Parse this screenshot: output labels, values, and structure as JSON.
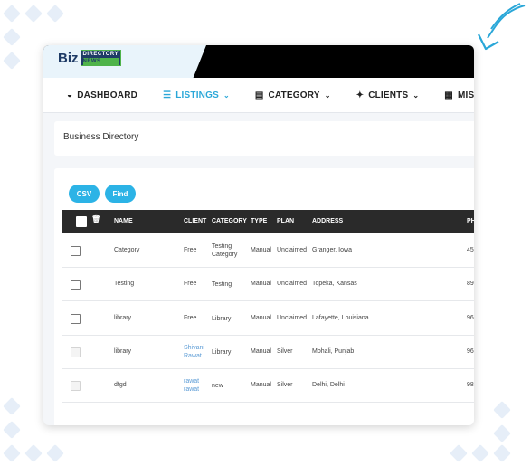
{
  "logo": {
    "biz": "Biz",
    "line1": "DIRECTORY",
    "line2": "NEWS"
  },
  "nav": [
    {
      "label": "DASHBOARD",
      "icon": "dashboard-icon",
      "glyph": "◒"
    },
    {
      "label": "LISTINGS",
      "icon": "list-icon",
      "glyph": "☰"
    },
    {
      "label": "CATEGORY",
      "icon": "category-icon",
      "glyph": "▤"
    },
    {
      "label": "CLIENTS",
      "icon": "users-icon",
      "glyph": "✦"
    },
    {
      "label": "MISCELLAN",
      "icon": "file-icon",
      "glyph": "▦"
    }
  ],
  "page_title": "Business Directory",
  "buttons": {
    "csv": "CSV",
    "find": "Find"
  },
  "table": {
    "headers": {
      "name": "NAME",
      "client": "CLIENT",
      "category": "CATEGORY",
      "type": "TYPE",
      "plan": "PLAN",
      "address": "ADDRESS",
      "ph": "PH"
    },
    "rows": [
      {
        "name": "Category",
        "client": "Free",
        "category": [
          "Testing",
          "Category"
        ],
        "type": "Manual",
        "plan": "Unclaimed",
        "address": "Granger, Iowa",
        "ph": "45"
      },
      {
        "name": "Testing",
        "client": "Free",
        "category": [
          "Testing"
        ],
        "type": "Manual",
        "plan": "Unclaimed",
        "address": "Topeka, Kansas",
        "ph": "89"
      },
      {
        "name": "library",
        "client": "Free",
        "category": [
          "Library"
        ],
        "type": "Manual",
        "plan": "Unclaimed",
        "address": "Lafayette, Louisiana",
        "ph": "96"
      },
      {
        "name": "library",
        "client": "Shivani Rawat",
        "category": [
          "Library"
        ],
        "type": "Manual",
        "plan": "Silver",
        "address": "Mohali, Punjab",
        "ph": "96"
      },
      {
        "name": "dfgd",
        "client": "rawat rawat",
        "category": [
          "new"
        ],
        "type": "Manual",
        "plan": "Silver",
        "address": "Delhi, Delhi",
        "ph": "98"
      }
    ]
  },
  "colors": {
    "accent": "#2cb3e6",
    "header_bg": "#2a2a2a",
    "topbar": "#000000",
    "link": "#5b9bd5"
  }
}
